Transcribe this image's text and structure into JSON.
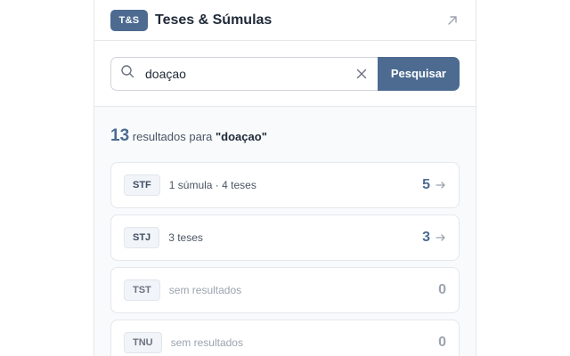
{
  "header": {
    "logo": "T&S",
    "title": "Teses & Súmulas"
  },
  "search": {
    "value": "doaçao",
    "button_label": "Pesquisar"
  },
  "summary": {
    "count": "13",
    "text": "resultados para",
    "query": "\"doaçao\""
  },
  "results": [
    {
      "court": "STF",
      "description": "1 súmula · 4 teses",
      "count": "5",
      "has_results": true
    },
    {
      "court": "STJ",
      "description": "3 teses",
      "count": "3",
      "has_results": true
    },
    {
      "court": "TST",
      "description": "sem resultados",
      "count": "0",
      "has_results": false
    },
    {
      "court": "TNU",
      "description": "sem resultados",
      "count": "0",
      "has_results": false
    }
  ],
  "colors": {
    "accent": "#4d6b91",
    "border": "#e5e7eb",
    "background": "#f8fafc"
  },
  "icons": {
    "open": "external-arrow-icon",
    "search": "search-icon",
    "clear": "close-icon",
    "result": "arrow-right-icon"
  }
}
